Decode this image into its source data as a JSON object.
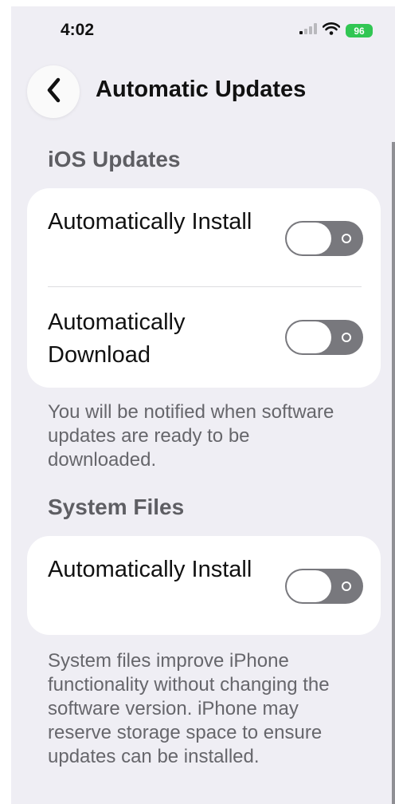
{
  "status_bar": {
    "time": "4:02",
    "battery": "96"
  },
  "nav": {
    "title": "Automatic Updates"
  },
  "ios_updates": {
    "header": "iOS Updates",
    "rows": [
      {
        "label": "Automatically Install",
        "enabled": false
      },
      {
        "label": "Automatically Download",
        "enabled": false
      }
    ],
    "footnote": "You will be notified when software updates are ready to be downloaded."
  },
  "system_files": {
    "header": "System Files",
    "rows": [
      {
        "label": "Automatically Install",
        "enabled": false
      }
    ],
    "footnote": "System files improve iPhone functionality without changing the software version. iPhone may reserve storage space to ensure updates can be installed."
  },
  "colors": {
    "background": "#efeef4",
    "toggle_off": "#78787d",
    "battery": "#31c653"
  }
}
